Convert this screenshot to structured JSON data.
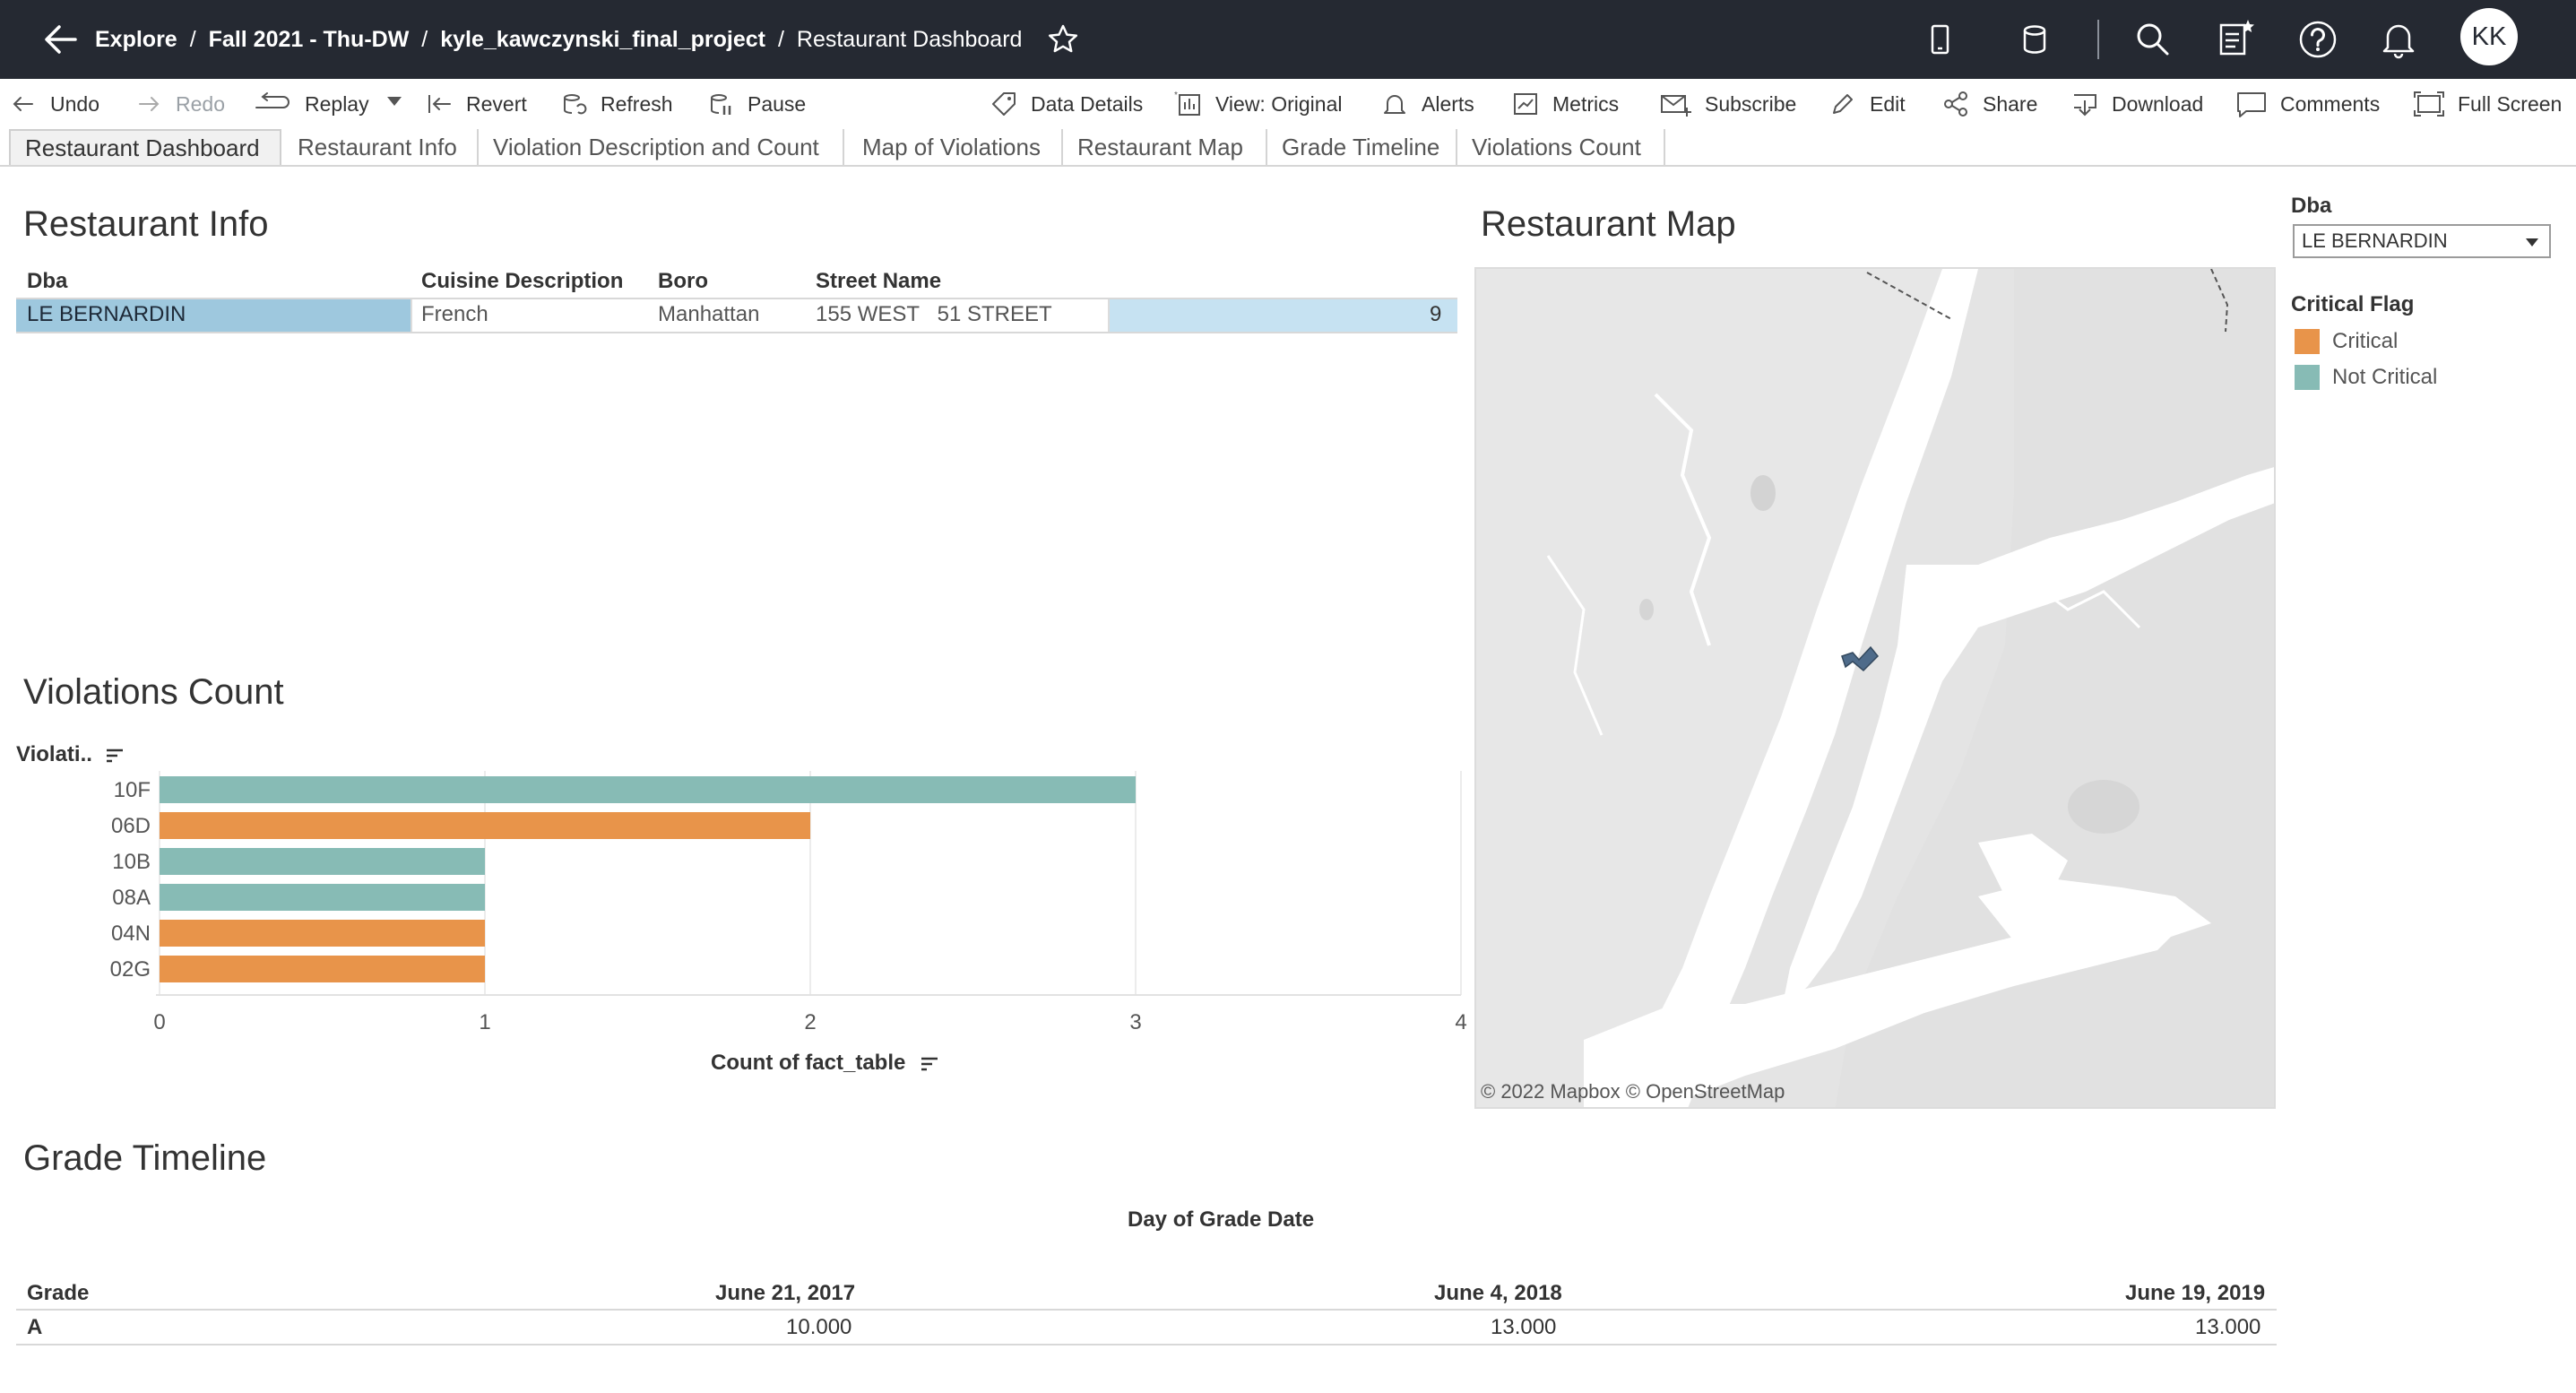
{
  "breadcrumb": {
    "items": [
      "Explore",
      "Fall 2021 - Thu-DW",
      "kyle_kawczynski_final_project"
    ],
    "current": "Restaurant Dashboard",
    "separator": "/"
  },
  "user": {
    "initials": "KK"
  },
  "toolbar": {
    "undo": "Undo",
    "redo": "Redo",
    "replay": "Replay",
    "revert": "Revert",
    "refresh": "Refresh",
    "pause": "Pause",
    "data_details": "Data Details",
    "view": "View: Original",
    "alerts": "Alerts",
    "metrics": "Metrics",
    "subscribe": "Subscribe",
    "edit": "Edit",
    "share": "Share",
    "download": "Download",
    "comments": "Comments",
    "full_screen": "Full Screen"
  },
  "tabs": [
    "Restaurant Dashboard",
    "Restaurant Info",
    "Violation Description and Count",
    "Map of Violations",
    "Restaurant Map",
    "Grade Timeline",
    "Violations Count"
  ],
  "restaurant_info": {
    "title": "Restaurant Info",
    "columns": [
      "Dba",
      "Cuisine Description",
      "Boro",
      "Street Name"
    ],
    "row": {
      "dba": "LE BERNARDIN",
      "cuisine": "French",
      "boro": "Manhattan",
      "street": "155 WEST   51 STREET",
      "count": "9"
    }
  },
  "violations": {
    "title": "Violations Count",
    "axis_title": "Violati..",
    "x_title": "Count of fact_table"
  },
  "chart_data": {
    "type": "bar",
    "orientation": "horizontal",
    "categories": [
      "10F",
      "06D",
      "10B",
      "08A",
      "04N",
      "02G"
    ],
    "values": [
      3,
      2,
      1,
      1,
      1,
      1
    ],
    "critical_flag": [
      "Not Critical",
      "Critical",
      "Not Critical",
      "Not Critical",
      "Critical",
      "Critical"
    ],
    "xlabel": "Count of fact_table",
    "ylabel": "Violati..",
    "xlim": [
      0,
      4
    ],
    "xticks": [
      "0",
      "1",
      "2",
      "3",
      "4"
    ],
    "grid": true,
    "colors": {
      "Critical": "#e8944a",
      "Not Critical": "#87bbb5"
    }
  },
  "map": {
    "title": "Restaurant Map",
    "attribution": "© 2022 Mapbox  © OpenStreetMap"
  },
  "filter": {
    "label": "Dba",
    "value": "LE BERNARDIN"
  },
  "legend": {
    "title": "Critical Flag",
    "items": [
      {
        "label": "Critical",
        "color": "#e8944a"
      },
      {
        "label": "Not Critical",
        "color": "#87bbb5"
      }
    ]
  },
  "grade_timeline": {
    "title": "Grade Timeline",
    "column_title": "Day of Grade Date",
    "row_header": "Grade",
    "dates": [
      "June 21, 2017",
      "June 4, 2018",
      "June 19, 2019"
    ],
    "grade": "A",
    "values": [
      "10.000",
      "13.000",
      "13.000"
    ]
  }
}
